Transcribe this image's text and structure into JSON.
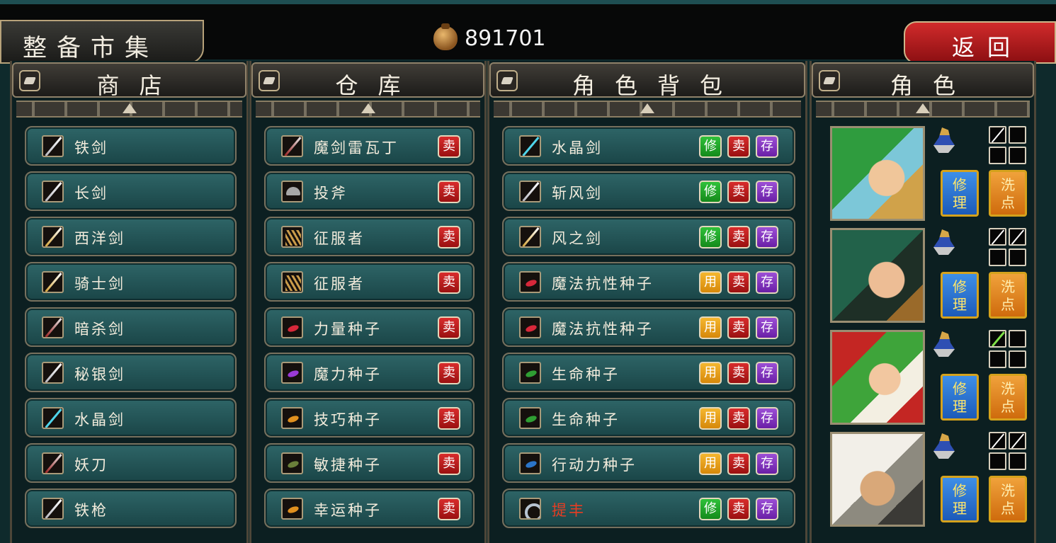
{
  "header": {
    "title": "整备市集",
    "gold": "891701",
    "back_label": "返回"
  },
  "columns": {
    "shop": "商店",
    "storage": "仓库",
    "bag": "角色背包",
    "roles": "角色"
  },
  "shop_items": [
    {
      "name": "铁剑",
      "icon": "sword-icon"
    },
    {
      "name": "长剑",
      "icon": "sword-icon"
    },
    {
      "name": "西洋剑",
      "icon": "gold-sword-icon"
    },
    {
      "name": "骑士剑",
      "icon": "gold-sword-icon"
    },
    {
      "name": "暗杀剑",
      "icon": "red-blade-icon"
    },
    {
      "name": "秘银剑",
      "icon": "sword-icon"
    },
    {
      "name": "水晶剑",
      "icon": "crystal-sword-icon"
    },
    {
      "name": "妖刀",
      "icon": "red-blade-icon"
    },
    {
      "name": "铁枪",
      "icon": "spear-icon"
    }
  ],
  "storage_items": [
    {
      "name": "魔剑雷瓦丁",
      "icon": "red-blade-icon"
    },
    {
      "name": "投斧",
      "icon": "axe-icon"
    },
    {
      "name": "征服者",
      "icon": "claw-icon"
    },
    {
      "name": "征服者",
      "icon": "claw-icon"
    },
    {
      "name": "力量种子",
      "icon": "seed-red-icon"
    },
    {
      "name": "魔力种子",
      "icon": "seed-purple-icon"
    },
    {
      "name": "技巧种子",
      "icon": "seed-orange-icon"
    },
    {
      "name": "敏捷种子",
      "icon": "seed-dark-icon"
    },
    {
      "name": "幸运种子",
      "icon": "seed-orange-icon"
    }
  ],
  "sell_label": "卖",
  "repair_label": "修",
  "store_label": "存",
  "use_label": "用",
  "bag_items": [
    {
      "name": "水晶剑",
      "icon": "crystal-sword-icon",
      "action": "修"
    },
    {
      "name": "斩风剑",
      "icon": "sword-icon",
      "action": "修"
    },
    {
      "name": "风之剑",
      "icon": "gold-sword-icon",
      "action": "修"
    },
    {
      "name": "魔法抗性种子",
      "icon": "seed-red-icon",
      "action": "用"
    },
    {
      "name": "魔法抗性种子",
      "icon": "seed-red-icon",
      "action": "用"
    },
    {
      "name": "生命种子",
      "icon": "seed-green-icon",
      "action": "用"
    },
    {
      "name": "生命种子",
      "icon": "seed-green-icon",
      "action": "用"
    },
    {
      "name": "行动力种子",
      "icon": "seed-blue-icon",
      "action": "用"
    },
    {
      "name": "提丰",
      "icon": "ring-icon",
      "action": "修",
      "highlight": true
    }
  ],
  "characters": [
    {
      "portrait": "green-haired-swordsman-portrait"
    },
    {
      "portrait": "green-haired-woman-portrait"
    },
    {
      "portrait": "red-hooded-woman-portrait"
    },
    {
      "portrait": "armored-man-portrait"
    }
  ],
  "char_repair_label": "修理",
  "char_wash_label": "洗点",
  "colors": {
    "sell": "#c41c1c",
    "repair": "#1f9e2a",
    "store": "#7f35bf",
    "use": "#e69a14",
    "back": "#b51c1f"
  }
}
